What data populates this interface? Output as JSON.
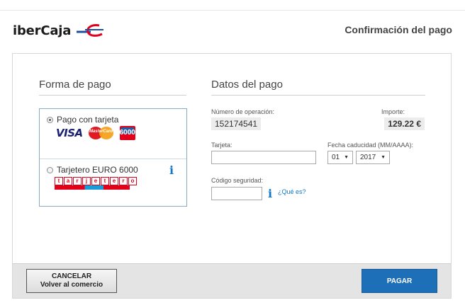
{
  "header": {
    "logo_text": "iberCaja",
    "title": "Confirmación del pago"
  },
  "payment_method": {
    "title": "Forma de pago",
    "options": [
      {
        "label": "Pago con tarjeta",
        "selected": true,
        "logos": [
          "VISA",
          "MasterCard",
          "6000"
        ]
      },
      {
        "label": "Tarjetero EURO 6000",
        "selected": false,
        "logo_letters": [
          "t",
          "a",
          "r",
          "j",
          "e",
          "t",
          "e",
          "r",
          "o"
        ]
      }
    ],
    "info_icon": "i"
  },
  "payment_data": {
    "title": "Datos del pago",
    "operation_label": "Número de operación:",
    "operation_value": "152174541",
    "amount_label": "Importe:",
    "amount_value": "129.22 €",
    "card_label": "Tarjeta:",
    "card_value": "",
    "expiry_label": "Fecha caducidad (MM/AAAA):",
    "expiry_month": "01",
    "expiry_year": "2017",
    "cvv_label": "Código seguridad:",
    "cvv_value": "",
    "info_icon": "i",
    "help_link": "¿Qué es?"
  },
  "footer": {
    "cancel_line1": "CANCELAR",
    "cancel_line2": "Volver al comercio",
    "pay_label": "PAGAR"
  },
  "colors": {
    "accent": "#1d6fb8",
    "link": "#1178c8",
    "footer_bg": "#e4e4e4"
  }
}
